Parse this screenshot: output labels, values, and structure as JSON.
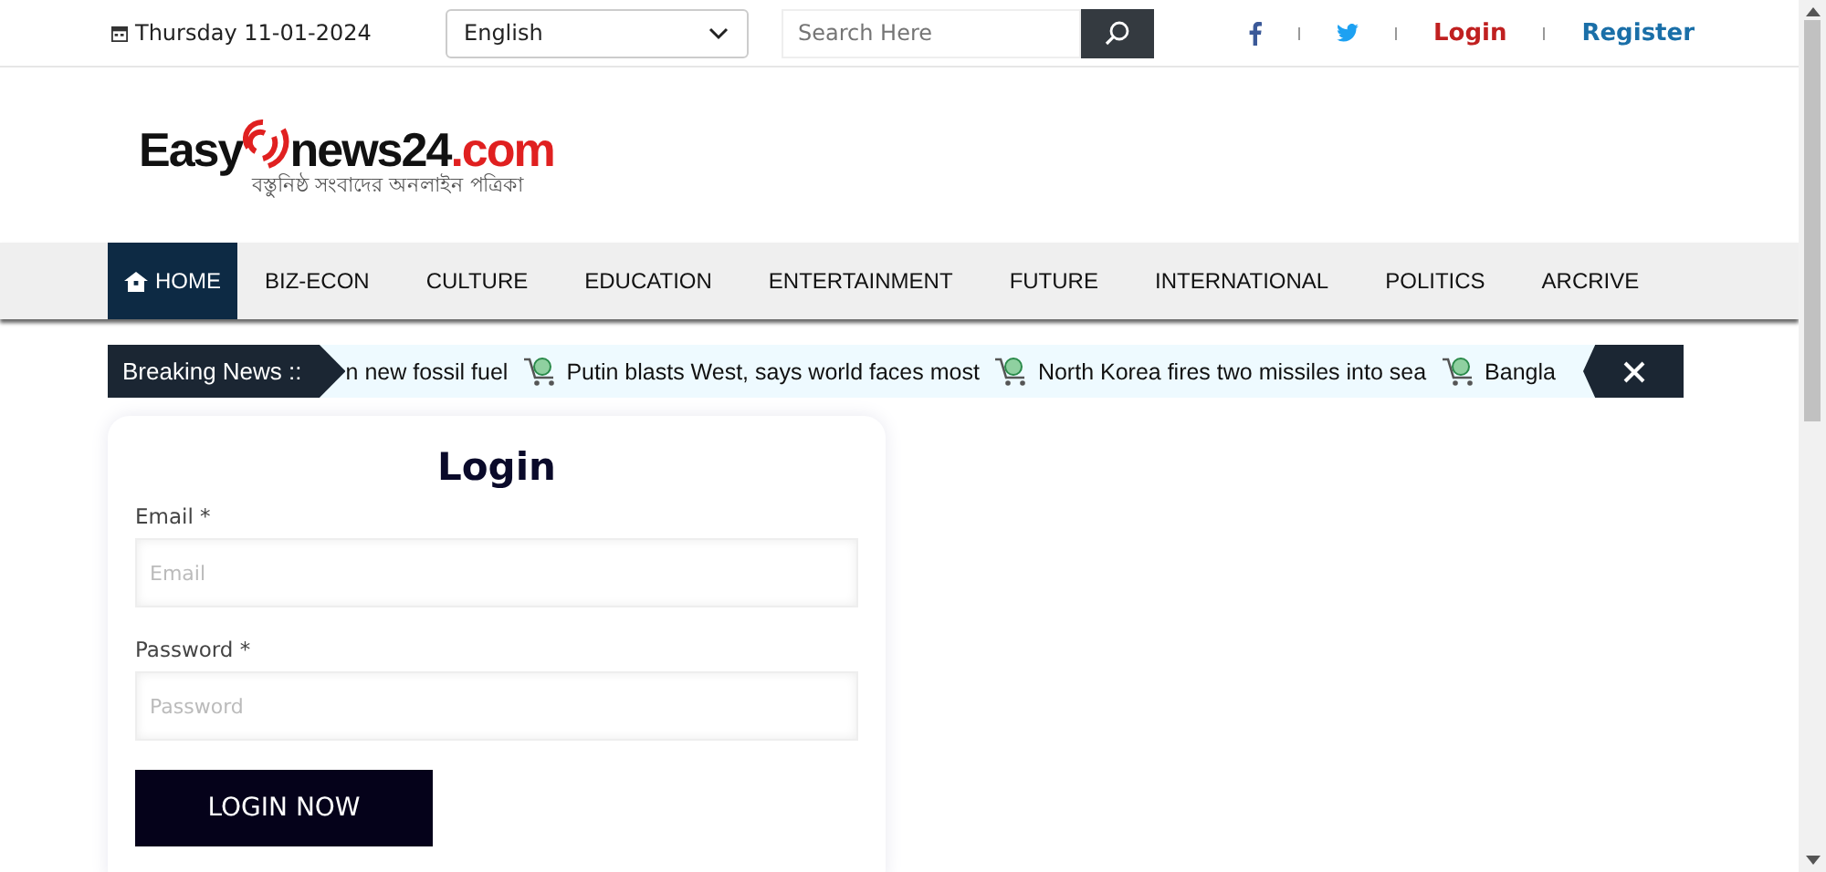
{
  "top_bar": {
    "date": "Thursday 11-01-2024",
    "language": "English",
    "search": {
      "placeholder": "Search Here"
    },
    "login": "Login",
    "register": "Register"
  },
  "logo": {
    "part_1": "Easy",
    "part_2": "news24",
    "part_3": ".com",
    "tagline": "বস্তুনিষ্ঠ সংবাদের অনলাইন পত্রিকা"
  },
  "nav": [
    {
      "label": "HOME",
      "selected": true
    },
    {
      "label": "BIZ-ECON",
      "selected": false
    },
    {
      "label": "CULTURE",
      "selected": false
    },
    {
      "label": "EDUCATION",
      "selected": false
    },
    {
      "label": "ENTERTAINMENT",
      "selected": false
    },
    {
      "label": "FUTURE",
      "selected": false
    },
    {
      "label": "INTERNATIONAL",
      "selected": false
    },
    {
      "label": "POLITICS",
      "selected": false
    },
    {
      "label": "ARCRIVE",
      "selected": false
    }
  ],
  "breaking": {
    "label": "Breaking News ::",
    "items": [
      {
        "text": "n new fossil fuel",
        "icon": false
      },
      {
        "text": "Putin blasts West, says world faces most",
        "icon": true
      },
      {
        "text": "North Korea fires two missiles into sea",
        "icon": true
      },
      {
        "text": "Bangla",
        "icon": true
      }
    ]
  },
  "login_form": {
    "title": "Login",
    "fields": [
      {
        "label": "Email *",
        "placeholder": "Email"
      },
      {
        "label": "Password *",
        "placeholder": "Password"
      }
    ],
    "button": "LOGIN NOW"
  }
}
